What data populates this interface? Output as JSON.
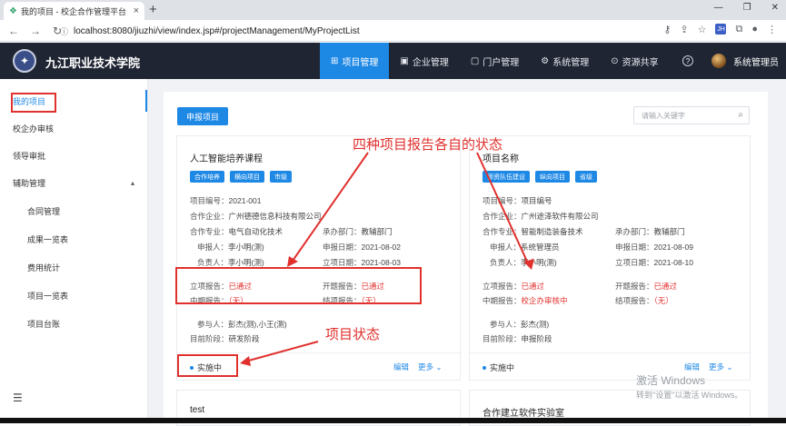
{
  "browser": {
    "tab_title": "我的项目 - 校企合作管理平台",
    "tab_close": "×",
    "new_tab": "+",
    "url": "localhost:8080/jiuzhi/view/index.jsp#/projectManagement/MyProjectList",
    "ext_label": "JH"
  },
  "header": {
    "school_name": "九江职业技术学院",
    "menu": [
      {
        "label": "项目管理",
        "icon": "⊞"
      },
      {
        "label": "企业管理",
        "icon": "▣"
      },
      {
        "label": "门户管理",
        "icon": "▢"
      },
      {
        "label": "系统管理",
        "icon": "⚙"
      },
      {
        "label": "资源共享",
        "icon": "⊙"
      }
    ],
    "help": "?",
    "user_name": "系统管理员"
  },
  "sidebar": {
    "items": [
      {
        "label": "我的项目"
      },
      {
        "label": "校企办审核"
      },
      {
        "label": "领导审批"
      },
      {
        "label": "辅助管理"
      },
      {
        "label": "合同管理"
      },
      {
        "label": "成果一览表"
      },
      {
        "label": "费用统计"
      },
      {
        "label": "项目一览表"
      },
      {
        "label": "项目台账"
      }
    ],
    "chevron": "▴",
    "collapse": "☰"
  },
  "toolbar": {
    "apply_label": "申报项目",
    "search_placeholder": "请输入关键字"
  },
  "cards": [
    {
      "title": "人工智能培养课程",
      "tags": [
        "合作培养",
        "横向项目",
        "市级"
      ],
      "code_label": "项目编号：",
      "code": "2021-001",
      "company_label": "合作企业：",
      "company": "广州德德信息科技有限公司",
      "major_label": "合作专业：",
      "major": "电气自动化技术",
      "dept_label": "承办部门：",
      "dept": "教辅部门",
      "applicant_label": "申报人：",
      "applicant": "李小明(测)",
      "apply_date_label": "申报日期：",
      "apply_date": "2021-08-02",
      "leader_label": "负责人：",
      "leader": "李小明(测)",
      "approve_date_label": "立项日期：",
      "approve_date": "2021-08-03",
      "report1_label": "立项报告：",
      "report1": "已通过",
      "report2_label": "开题报告：",
      "report2": "已通过",
      "report3_label": "中期报告：",
      "report3": "（无）",
      "report4_label": "结项报告：",
      "report4": "（无）",
      "members_label": "参与人：",
      "members": "彭杰(测),小王(测)",
      "stage_label": "目前阶段：",
      "stage": "研发阶段",
      "status": "实施中",
      "edit": "编辑",
      "more": "更多 ⌄"
    },
    {
      "title": "项目名称",
      "tags": [
        "师资队伍建设",
        "纵向项目",
        "省级"
      ],
      "code_label": "项目编号：",
      "code": "项目编号",
      "company_label": "合作企业：",
      "company": "广州途泽软件有限公司",
      "major_label": "合作专业：",
      "major": "智能制造装备技术",
      "dept_label": "承办部门：",
      "dept": "教辅部门",
      "applicant_label": "申报人：",
      "applicant": "系统管理员",
      "apply_date_label": "申报日期：",
      "apply_date": "2021-08-09",
      "leader_label": "负责人：",
      "leader": "李小明(测)",
      "approve_date_label": "立项日期：",
      "approve_date": "2021-08-10",
      "report1_label": "立项报告：",
      "report1": "已通过",
      "report2_label": "开题报告：",
      "report2": "已通过",
      "report3_label": "中期报告：",
      "report3": "校企办审核中",
      "report4_label": "结项报告：",
      "report4": "（无）",
      "members_label": "参与人：",
      "members": "彭杰(测)",
      "stage_label": "目前阶段：",
      "stage": "申报阶段",
      "status": "实施中",
      "edit": "编辑",
      "more": "更多 ⌄"
    },
    {
      "title": "test"
    },
    {
      "title": "合作建立软件实验室"
    }
  ],
  "annotations": {
    "report_status": "四种项目报告各自的状态",
    "project_status": "项目状态"
  },
  "watermark": {
    "line1": "激活 Windows",
    "line2": "转到\"设置\"以激活 Windows。"
  },
  "colors": {
    "accent": "#1e88e5",
    "header_bg": "#1f2533",
    "annotation": "#e0312e"
  }
}
